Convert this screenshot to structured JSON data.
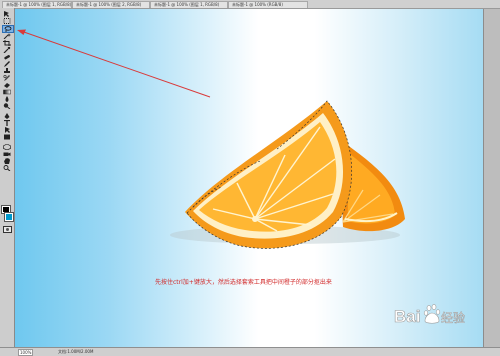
{
  "tabs": [
    {
      "label": "未标题-1 @ 100% (图层 1, RGB/8)"
    },
    {
      "label": "未标题-1 @ 100% (图层 2, RGB/8)"
    },
    {
      "label": "未标题-1 @ 100% (图层 1, RGB/8)"
    },
    {
      "label": "未标题-1 @ 100% (RGB/8)"
    }
  ],
  "tools": [
    {
      "icon": "move-tool-icon"
    },
    {
      "icon": "marquee-tool-icon"
    },
    {
      "icon": "lasso-tool-icon"
    },
    {
      "icon": "magic-wand-tool-icon"
    },
    {
      "icon": "crop-tool-icon"
    },
    {
      "icon": "eyedropper-tool-icon"
    },
    {
      "icon": "healing-brush-tool-icon"
    },
    {
      "icon": "brush-tool-icon"
    },
    {
      "icon": "clone-stamp-tool-icon"
    },
    {
      "icon": "history-brush-tool-icon"
    },
    {
      "icon": "eraser-tool-icon"
    },
    {
      "icon": "gradient-tool-icon"
    },
    {
      "icon": "blur-tool-icon"
    },
    {
      "icon": "dodge-tool-icon"
    },
    {
      "icon": "pen-tool-icon"
    },
    {
      "icon": "type-tool-icon"
    },
    {
      "icon": "path-selection-tool-icon"
    },
    {
      "icon": "shape-tool-icon"
    },
    {
      "icon": "3d-rotate-tool-icon"
    },
    {
      "icon": "3d-camera-tool-icon"
    },
    {
      "icon": "hand-tool-icon"
    },
    {
      "icon": "zoom-tool-icon"
    }
  ],
  "colors": {
    "foreground": "#000000",
    "background": "#0099cc",
    "annotation_arrow": "#d93a3a",
    "caption": "#d22a2a",
    "orange_peel": "#f59a1b",
    "orange_flesh": "#ffb733"
  },
  "caption": "先按住ctrl加+键放大，然后选择套索工具把中间橙子的部分抠出来",
  "watermark": {
    "brand": "Baidu",
    "product": "经验"
  },
  "statusbar": {
    "zoom": "100%",
    "doc_info": "文档:1.00M/2.00M"
  }
}
